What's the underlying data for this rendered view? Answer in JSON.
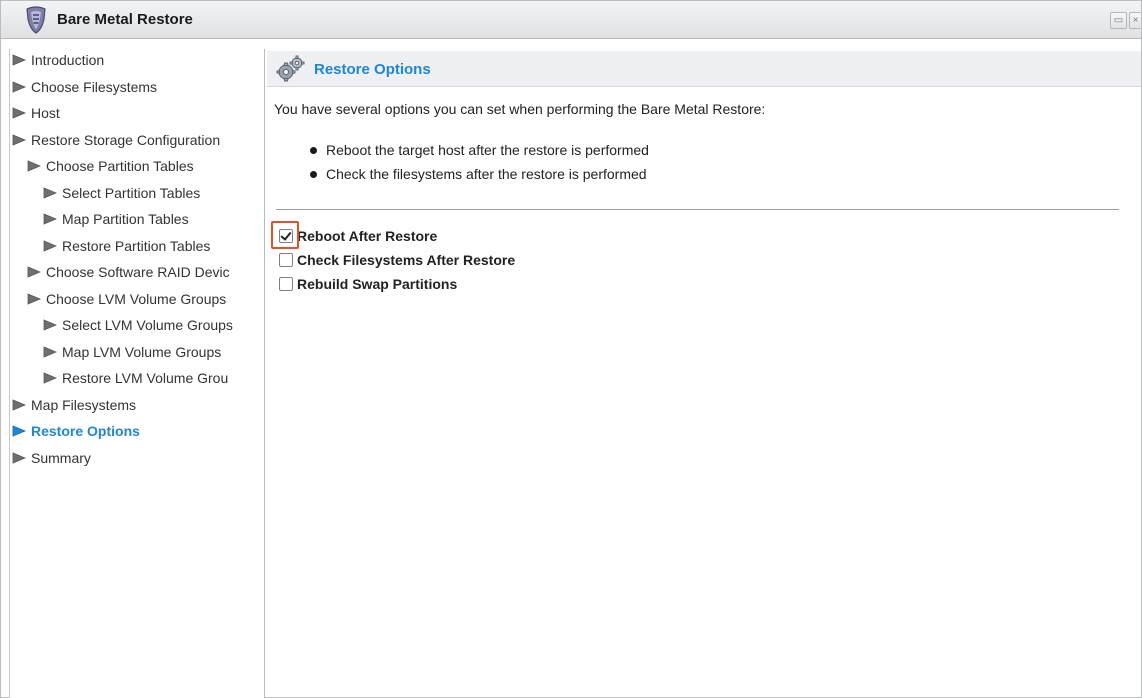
{
  "window": {
    "title": "Bare Metal Restore",
    "icon": "shield-icon",
    "buttons": [
      "restore-icon",
      "close-icon"
    ]
  },
  "sidebar": {
    "items": [
      {
        "label": "Introduction",
        "level": 0,
        "active": false
      },
      {
        "label": "Choose Filesystems",
        "level": 0,
        "active": false
      },
      {
        "label": "Host",
        "level": 0,
        "active": false
      },
      {
        "label": "Restore Storage Configuration",
        "level": 0,
        "active": false
      },
      {
        "label": "Choose Partition Tables",
        "level": 1,
        "active": false
      },
      {
        "label": "Select Partition Tables",
        "level": 2,
        "active": false
      },
      {
        "label": "Map Partition Tables",
        "level": 2,
        "active": false
      },
      {
        "label": "Restore Partition Tables",
        "level": 2,
        "active": false
      },
      {
        "label": "Choose Software RAID Devic",
        "level": 1,
        "active": false
      },
      {
        "label": "Choose LVM Volume Groups",
        "level": 1,
        "active": false
      },
      {
        "label": "Select LVM Volume Groups",
        "level": 2,
        "active": false
      },
      {
        "label": "Map LVM Volume Groups",
        "level": 2,
        "active": false
      },
      {
        "label": "Restore LVM Volume Grou",
        "level": 2,
        "active": false
      },
      {
        "label": "Map Filesystems",
        "level": 0,
        "active": false
      },
      {
        "label": "Restore Options",
        "level": 0,
        "active": true
      },
      {
        "label": "Summary",
        "level": 0,
        "active": false
      }
    ]
  },
  "main": {
    "section_title": "Restore Options",
    "section_icon": "gear-icon",
    "intro": "You have several options you can set when performing the Bare Metal Restore:",
    "bullets": [
      "Reboot the target host after the restore is performed",
      "Check the filesystems after the restore is performed"
    ],
    "options": [
      {
        "label": "Reboot After Restore",
        "checked": true
      },
      {
        "label": "Check Filesystems After Restore",
        "checked": false
      },
      {
        "label": "Rebuild Swap Partitions",
        "checked": false
      }
    ]
  },
  "colors": {
    "accent": "#1e86d9",
    "focus": "#e0522a"
  }
}
